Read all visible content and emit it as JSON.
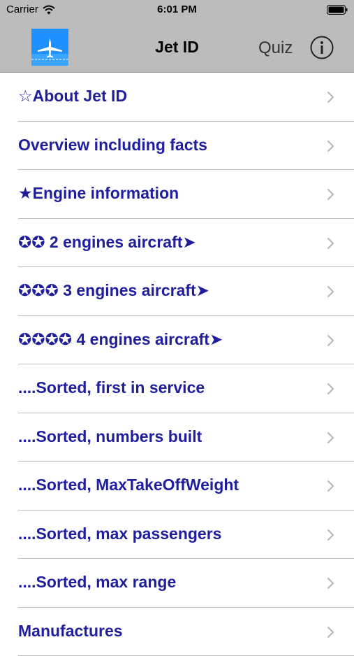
{
  "status_bar": {
    "carrier": "Carrier",
    "time": "6:01 PM"
  },
  "nav": {
    "title": "Jet ID",
    "quiz_label": "Quiz",
    "info_icon": "info-circle-icon",
    "logo_icon": "airplane-logo-icon"
  },
  "colors": {
    "bar_background": "#bcbcbc",
    "menu_text": "#1f1f9e",
    "separator": "#bdbdbd",
    "chevron": "#b5b5b5",
    "logo_blue": "#1e90ff"
  },
  "menu": {
    "items": [
      {
        "label": "☆About Jet ID"
      },
      {
        "label": "Overview including facts"
      },
      {
        "label": "★Engine information"
      },
      {
        "label": "✪✪ 2 engines aircraft➤"
      },
      {
        "label": "✪✪✪ 3 engines aircraft➤"
      },
      {
        "label": "✪✪✪✪ 4 engines aircraft➤"
      },
      {
        "label": "....Sorted, first in service"
      },
      {
        "label": "....Sorted, numbers built"
      },
      {
        "label": "....Sorted, MaxTakeOffWeight"
      },
      {
        "label": "....Sorted, max passengers"
      },
      {
        "label": "....Sorted, max range"
      },
      {
        "label": "Manufactures"
      }
    ]
  }
}
